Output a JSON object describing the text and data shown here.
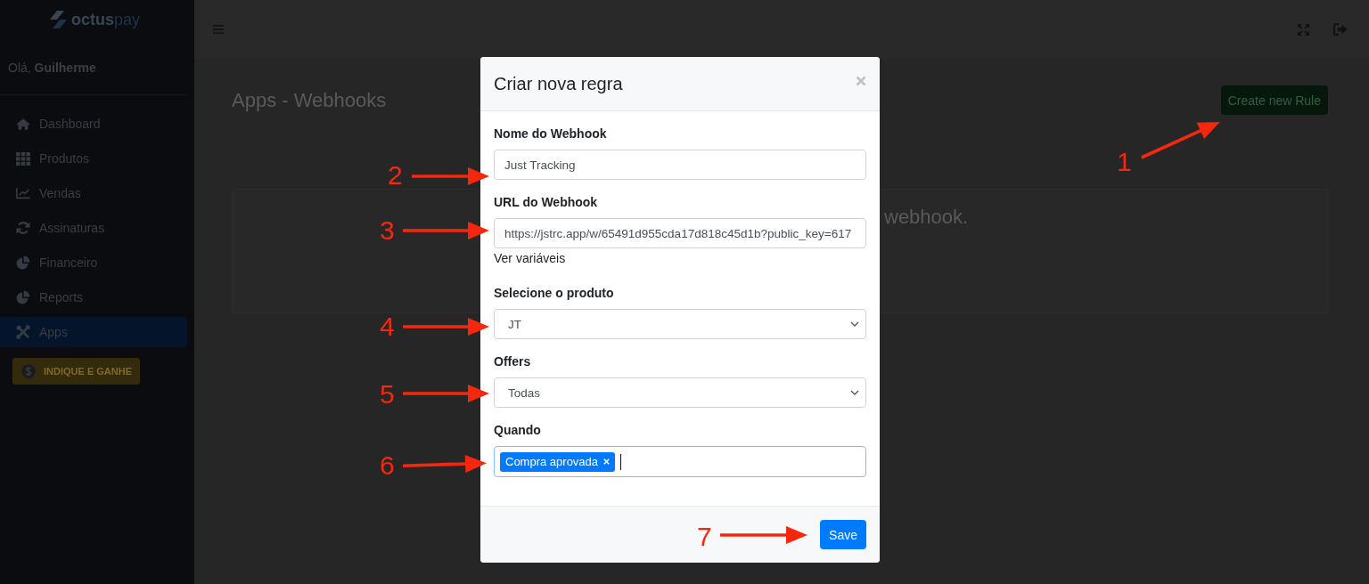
{
  "sidebar": {
    "logo": {
      "parts": [
        "octus",
        "pay"
      ]
    },
    "greeting": "Olá, **Guilherme**",
    "items": [
      {
        "label": "Dashboard",
        "selected": false
      },
      {
        "label": "Produtos",
        "selected": false
      },
      {
        "label": "Vendas",
        "selected": false
      },
      {
        "label": "Assinaturas",
        "selected": false
      },
      {
        "label": "Financeiro",
        "selected": false
      },
      {
        "label": "Reports",
        "selected": false
      },
      {
        "label": "Apps",
        "selected": true
      }
    ],
    "promo_button": "INDIQUE E GANHE"
  },
  "page": {
    "title": "Apps - Webhooks",
    "create_button": "Create new Rule",
    "empty_message": "webhook."
  },
  "modal": {
    "title": "Criar nova regra",
    "fields": [
      {
        "kind": "text",
        "label": "Nome do Webhook",
        "value": "Just Tracking"
      },
      {
        "kind": "text",
        "label": "URL do Webhook",
        "value": "https://jstrc.app/w/65491d955cda17d818c45d1b?public_key=617",
        "help": "Ver variáveis"
      },
      {
        "kind": "select",
        "label": "Selecione o produto",
        "value": "JT"
      },
      {
        "kind": "select",
        "label": "Offers",
        "value": "Todas"
      },
      {
        "kind": "tags",
        "label": "Quando",
        "tags": [
          "Compra aprovada"
        ],
        "focused": true
      }
    ],
    "save_button": "Save"
  },
  "annotations": [
    {
      "label": "1"
    },
    {
      "label": "2"
    },
    {
      "label": "3"
    },
    {
      "label": "4"
    },
    {
      "label": "5"
    },
    {
      "label": "6"
    },
    {
      "label": "7"
    }
  ]
}
